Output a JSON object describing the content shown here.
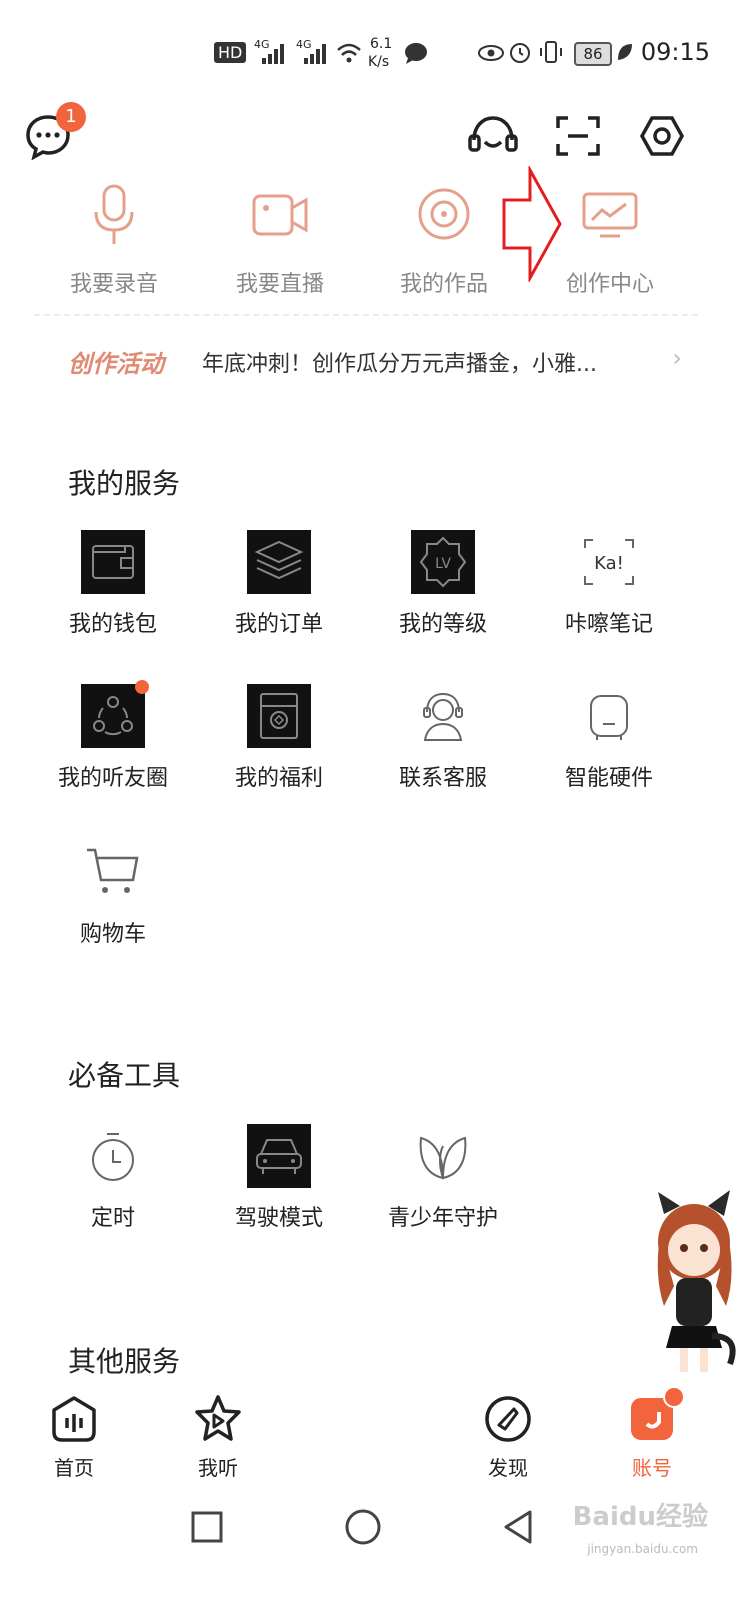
{
  "status_bar": {
    "network": "HD",
    "signal1": "4G",
    "signal2": "4G",
    "speed_value": "6.1",
    "speed_unit": "K/s",
    "battery": "86",
    "time": "09:15"
  },
  "top_bar": {
    "message_badge": "1",
    "icons": [
      "message-icon",
      "headset-icon",
      "scan-icon",
      "settings-icon"
    ]
  },
  "creator": {
    "items": [
      {
        "label": "我要录音",
        "icon": "microphone-icon"
      },
      {
        "label": "我要直播",
        "icon": "video-camera-icon"
      },
      {
        "label": "我的作品",
        "icon": "disc-icon"
      },
      {
        "label": "创作中心",
        "icon": "monitor-chart-icon"
      }
    ]
  },
  "activity": {
    "tag": "创作活动",
    "text": "年底冲刺！创作瓜分万元声播金，小雅...",
    "arrow": "›"
  },
  "my_services": {
    "title": "我的服务",
    "items": [
      {
        "label": "我的钱包",
        "icon": "wallet-icon"
      },
      {
        "label": "我的订单",
        "icon": "layers-icon"
      },
      {
        "label": "我的等级",
        "icon": "level-badge-icon"
      },
      {
        "label": "咔嚓笔记",
        "icon": "ka-note-icon"
      },
      {
        "label": "我的听友圈",
        "icon": "friends-circle-icon"
      },
      {
        "label": "我的福利",
        "icon": "gift-box-icon"
      },
      {
        "label": "联系客服",
        "icon": "customer-service-icon"
      },
      {
        "label": "智能硬件",
        "icon": "smart-speaker-icon"
      },
      {
        "label": "购物车",
        "icon": "cart-icon"
      }
    ]
  },
  "tools": {
    "title": "必备工具",
    "items": [
      {
        "label": "定时",
        "icon": "timer-icon"
      },
      {
        "label": "驾驶模式",
        "icon": "car-icon"
      },
      {
        "label": "青少年守护",
        "icon": "leaf-icon"
      }
    ]
  },
  "other": {
    "title": "其他服务"
  },
  "tabbar": {
    "tabs": [
      {
        "label": "首页"
      },
      {
        "label": "我听"
      },
      {
        "label": "发现"
      },
      {
        "label": "账号"
      }
    ]
  },
  "watermark": {
    "text": "Baidu经验",
    "sub": "jingyan.baidu.com"
  },
  "colors": {
    "accent": "#f2643c",
    "creator_icon": "#e5a08c",
    "arrow_annotation": "#e02020"
  }
}
